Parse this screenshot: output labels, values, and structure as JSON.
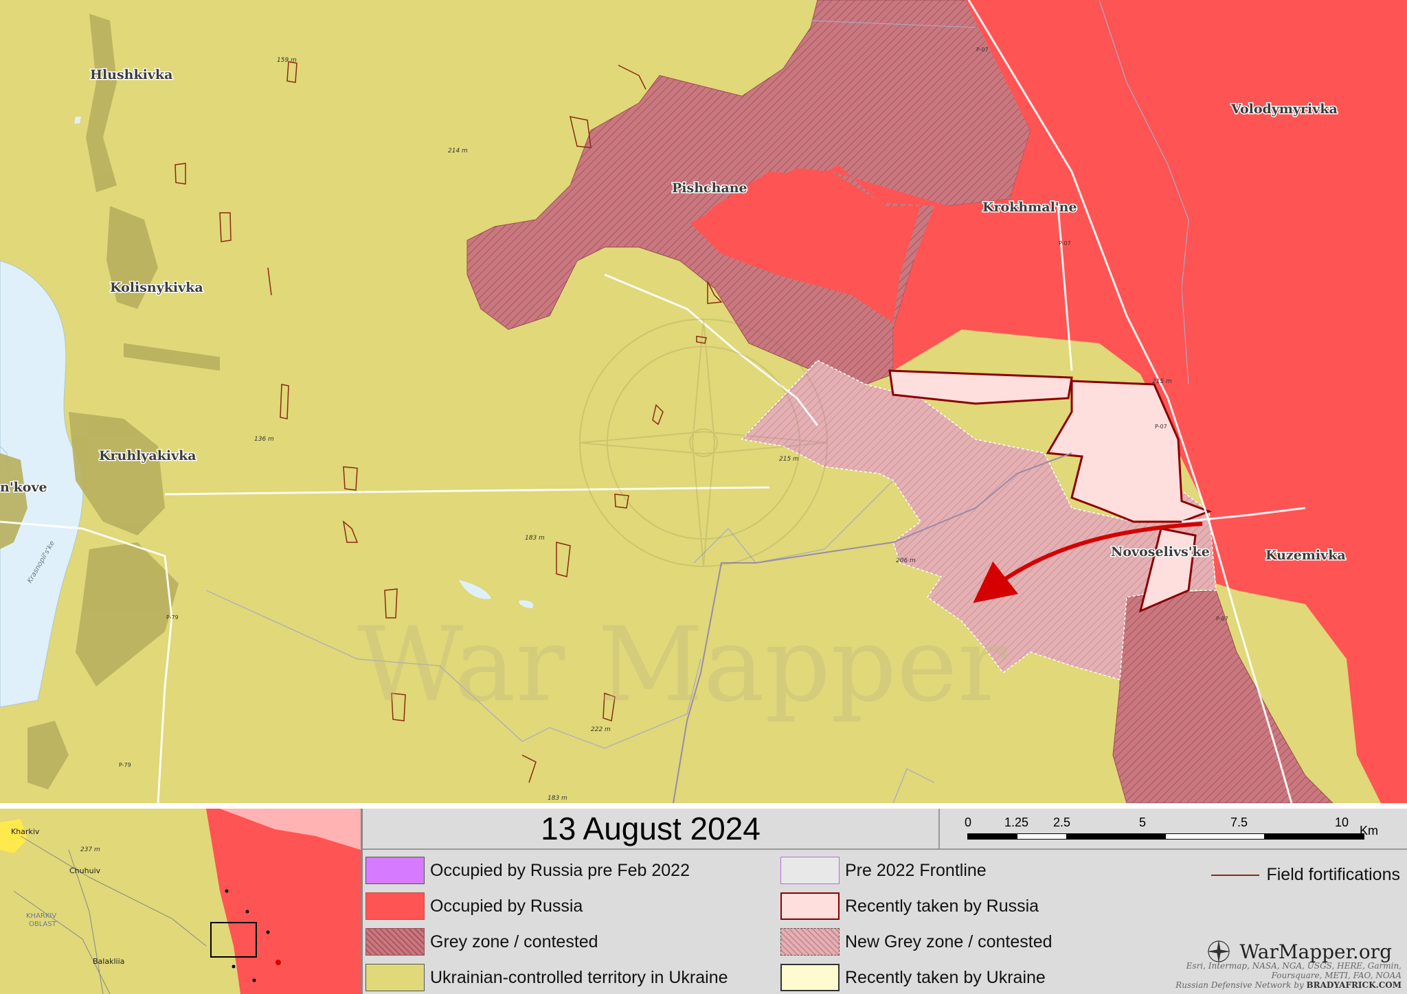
{
  "map": {
    "places": [
      "Hlushkivka",
      "Kolisnykivka",
      "Kruhlyakivka",
      "Pishchane",
      "Krokhmal'ne",
      "Volodymyrivka",
      "Novoselivs'ke",
      "Kuzemivka",
      "n'kove"
    ],
    "elevations": [
      "159 m",
      "214 m",
      "136 m",
      "183 m",
      "215 m",
      "215 m",
      "206 m",
      "222 m",
      "183 m"
    ],
    "roads": [
      "P-07",
      "P-07",
      "P-07",
      "P-07",
      "P-79",
      "P-79"
    ],
    "water_labels": [
      "Krasnopil's'ke"
    ],
    "watermark": "War Mapper"
  },
  "inset": {
    "places": [
      "Kharkiv",
      "Chuhuiv",
      "Balakliia"
    ],
    "region": [
      "KHARKIV",
      "OBLAST"
    ],
    "elevation": "237 m"
  },
  "legend": {
    "date": "13 August 2024",
    "scale": {
      "ticks": [
        "0",
        "1.25",
        "2.5",
        "5",
        "7.5",
        "10"
      ],
      "unit": "Km"
    },
    "items": [
      {
        "label": "Occupied by Russia pre Feb 2022"
      },
      {
        "label": "Occupied by Russia"
      },
      {
        "label": "Grey zone / contested"
      },
      {
        "label": "Ukrainian-controlled territory in Ukraine"
      },
      {
        "label": "Pre 2022 Frontline"
      },
      {
        "label": "Recently taken by Russia"
      },
      {
        "label": "New Grey zone / contested"
      },
      {
        "label": "Recently taken by Ukraine"
      }
    ],
    "field_fortifications": "Field fortifications",
    "brand": "WarMapper.org",
    "credits": [
      "Esri, Intermap, NASA, NGA, USGS, HERE, Garmin,",
      "Foursquare, METI, FAO, NOAA"
    ],
    "network": "Russian Defensive Network by ",
    "network_url": "BRADYAFRICK.COM"
  },
  "colors": {
    "ukraine": "#e0d879",
    "russia": "#ff5454",
    "russia_pre2022": "#d67bff",
    "grey_zone": "#c9757d",
    "new_grey_zone": "#e2a7aa",
    "recently_russia": "#ffdede",
    "recently_ukraine": "#fffbd0",
    "water": "#dff0fa",
    "settlement": "#b5ad60",
    "fortification": "#8a2a10",
    "arrow": "#d40000"
  }
}
